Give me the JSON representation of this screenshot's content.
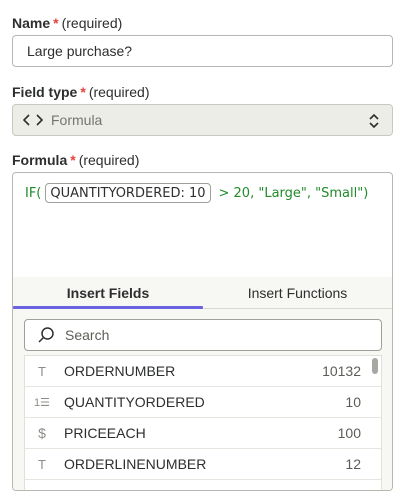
{
  "name_field": {
    "label": "Name",
    "required_mark": "*",
    "required_text": "(required)",
    "value": "Large purchase?"
  },
  "field_type": {
    "label": "Field type",
    "required_mark": "*",
    "required_text": "(required)",
    "value": "Formula",
    "icon": "code-icon"
  },
  "formula": {
    "label": "Formula",
    "required_mark": "*",
    "required_text": "(required)",
    "prefix": "IF(",
    "token": "QUANTITYORDERED: 10",
    "suffix": "> 20, \"Large\", \"Small\")"
  },
  "panel": {
    "tabs": [
      {
        "label": "Insert Fields",
        "active": true
      },
      {
        "label": "Insert Functions",
        "active": false
      }
    ],
    "search_placeholder": "Search",
    "fields": [
      {
        "icon": "text-type-icon",
        "glyph": "T",
        "name": "ORDERNUMBER",
        "value": "10132"
      },
      {
        "icon": "number-type-icon",
        "glyph": "1☰",
        "name": "QUANTITYORDERED",
        "value": "10"
      },
      {
        "icon": "currency-type-icon",
        "glyph": "$",
        "name": "PRICEEACH",
        "value": "100"
      },
      {
        "icon": "text-type-icon",
        "glyph": "T",
        "name": "ORDERLINENUMBER",
        "value": "12"
      }
    ]
  },
  "colors": {
    "required_star": "#e0443b",
    "formula_text": "#218a2a",
    "tab_accent": "#6a62e0"
  }
}
